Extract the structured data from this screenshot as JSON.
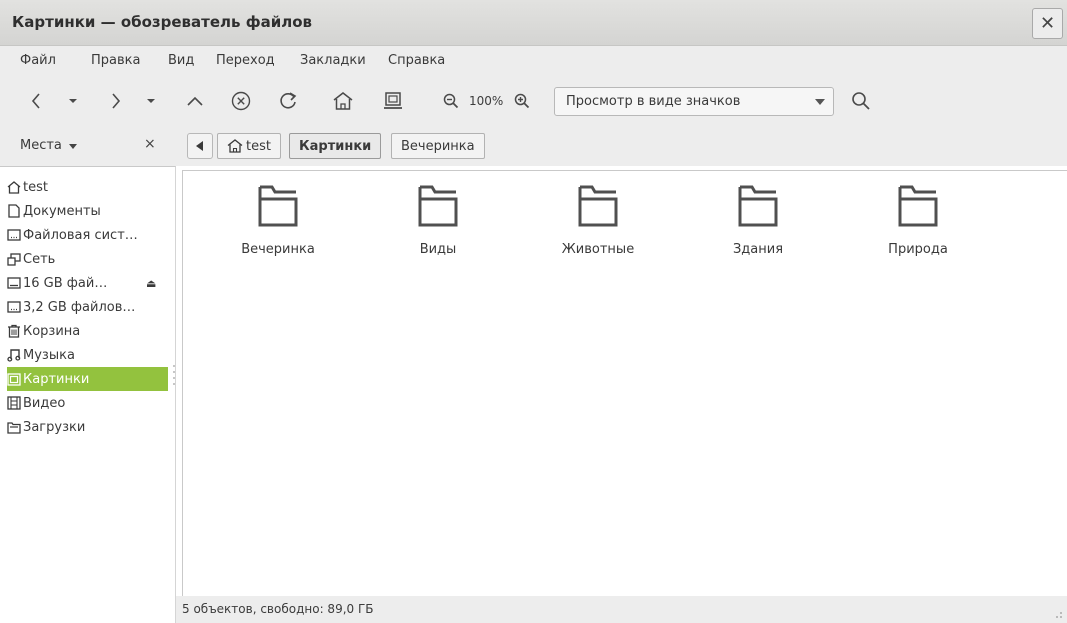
{
  "window": {
    "title": "Картинки — обозреватель файлов"
  },
  "menu": [
    "Файл",
    "Правка",
    "Вид",
    "Переход",
    "Закладки",
    "Справка"
  ],
  "toolbar": {
    "zoom_level": "100%",
    "view_mode": "Просмотр в виде значков"
  },
  "location": {
    "places_label": "Места",
    "places_close": "×",
    "breadcrumbs": [
      "test",
      "Картинки",
      "Вечеринка"
    ],
    "active_crumb": "Картинки"
  },
  "sidebar": {
    "items": [
      {
        "label": "test",
        "icon": "home-icon"
      },
      {
        "label": "Документы",
        "icon": "document-icon"
      },
      {
        "label": "Файловая сист…",
        "icon": "drive-icon"
      },
      {
        "label": "Сеть",
        "icon": "network-icon"
      },
      {
        "label": "16 GB фай…",
        "icon": "removable-drive-icon",
        "eject": "⏏"
      },
      {
        "label": "3,2 GB файлов…",
        "icon": "drive-icon"
      },
      {
        "label": "Корзина",
        "icon": "trash-icon"
      },
      {
        "label": "Музыка",
        "icon": "music-icon"
      },
      {
        "label": "Картинки",
        "icon": "pictures-icon",
        "active": true
      },
      {
        "label": "Видео",
        "icon": "video-icon"
      },
      {
        "label": "Загрузки",
        "icon": "downloads-icon"
      }
    ]
  },
  "files": [
    {
      "name": "Вечеринка",
      "icon": "folder-icon"
    },
    {
      "name": "Виды",
      "icon": "folder-icon"
    },
    {
      "name": "Животные",
      "icon": "folder-icon"
    },
    {
      "name": "Здания",
      "icon": "folder-icon"
    },
    {
      "name": "Природа",
      "icon": "folder-icon"
    }
  ],
  "status": {
    "text": "5 объектов, свободно: 89,0 ГБ"
  },
  "colors": {
    "accent": "#93c23e",
    "chrome": "#ededed",
    "titlebar": "#d9d9d7"
  }
}
